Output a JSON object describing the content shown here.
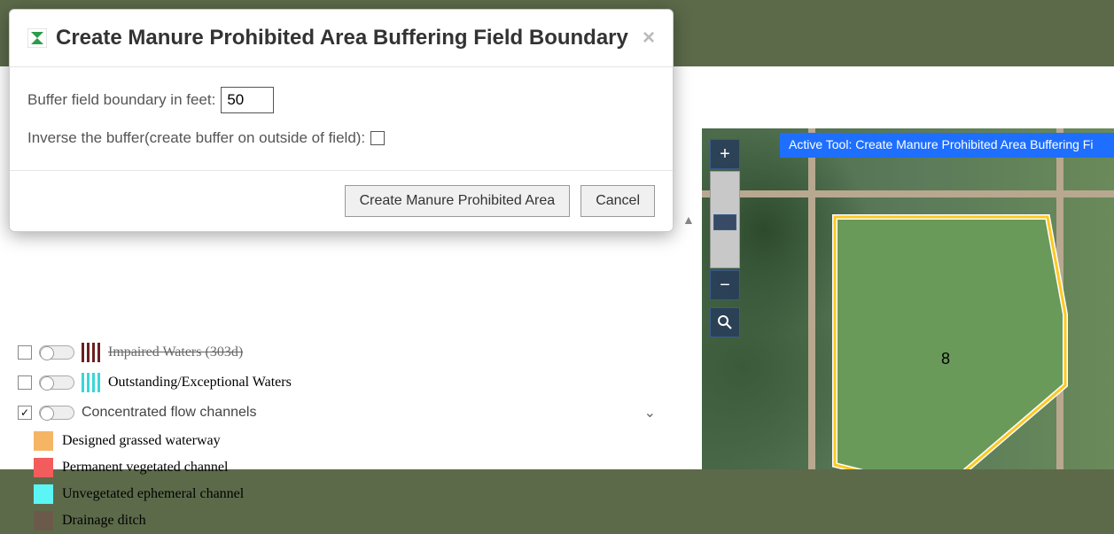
{
  "modal": {
    "title": "Create Manure Prohibited Area Buffering Field Boundary",
    "buffer_label": "Buffer field boundary in feet:",
    "buffer_value": "50",
    "inverse_label": "Inverse the buffer(create buffer on outside of field):",
    "create_button": "Create Manure Prohibited Area",
    "cancel_button": "Cancel"
  },
  "active_tool": {
    "label": "Active Tool: Create Manure Prohibited Area Buffering Fi"
  },
  "map": {
    "field_number": "8"
  },
  "layers": {
    "impaired": {
      "label": "Impaired Waters (303d)",
      "color": "#6b2020"
    },
    "outstanding": {
      "label": "Outstanding/Exceptional Waters",
      "color": "#3ad6d6"
    },
    "concentrated": {
      "label": "Concentrated flow channels"
    },
    "sub": [
      {
        "label": "Designed grassed waterway",
        "color": "#f5b565"
      },
      {
        "label": "Permanent vegetated channel",
        "color": "#f25c5c"
      },
      {
        "label": "Unvegetated ephemeral channel",
        "color": "#5cf5f5"
      },
      {
        "label": "Drainage ditch",
        "color": "#6b5a4a"
      }
    ]
  }
}
